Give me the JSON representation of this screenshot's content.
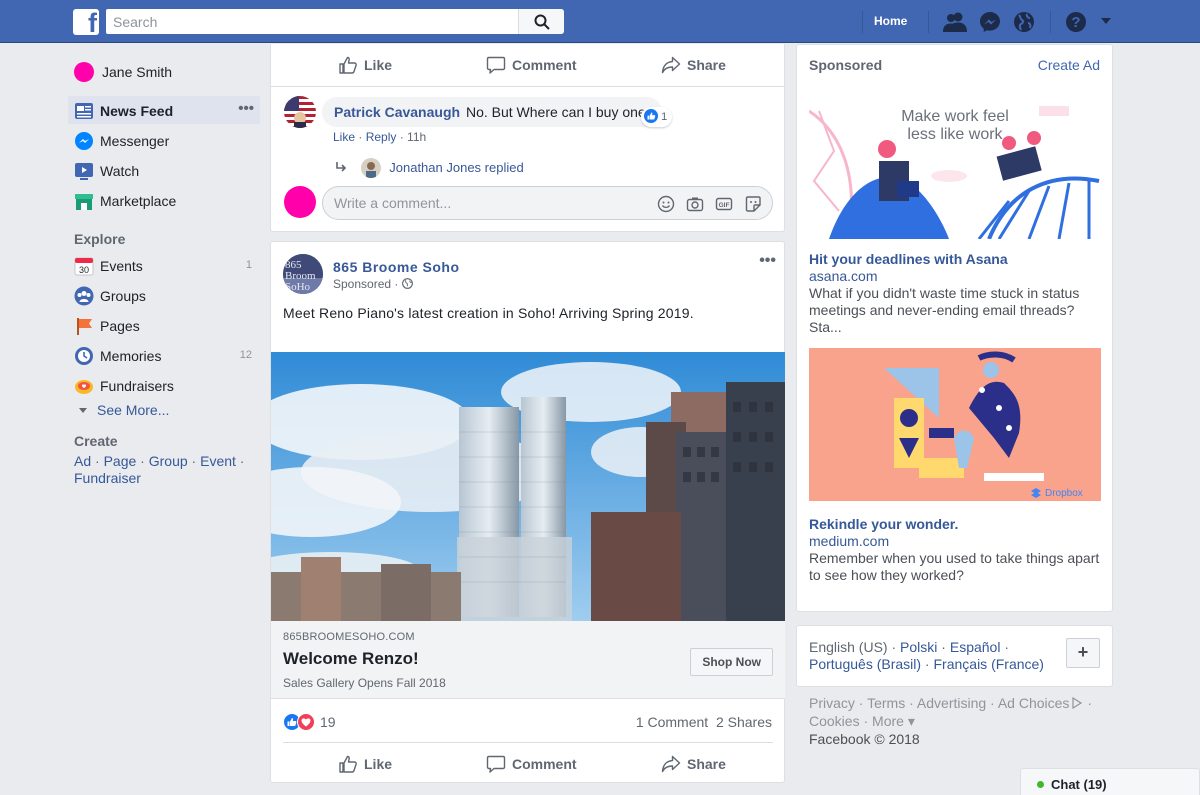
{
  "header": {
    "search_placeholder": "Search",
    "home_label": "Home"
  },
  "leftnav": {
    "user_name": "Jane Smith",
    "items": [
      {
        "label": "News Feed",
        "count": ""
      },
      {
        "label": "Messenger",
        "count": ""
      },
      {
        "label": "Watch",
        "count": ""
      },
      {
        "label": "Marketplace",
        "count": ""
      }
    ],
    "explore_title": "Explore",
    "explore": [
      {
        "label": "Events",
        "count": "1"
      },
      {
        "label": "Groups",
        "count": ""
      },
      {
        "label": "Pages",
        "count": ""
      },
      {
        "label": "Memories",
        "count": "12"
      },
      {
        "label": "Fundraisers",
        "count": ""
      }
    ],
    "see_more": "See More...",
    "create_title": "Create",
    "create_links": [
      "Ad",
      "Page",
      "Group",
      "Event",
      "Fundraiser"
    ]
  },
  "actions": {
    "like": "Like",
    "comment": "Comment",
    "share": "Share"
  },
  "comment": {
    "author": "Patrick Cavanaugh",
    "text": "No. But Where can I buy one.",
    "like_count": "1",
    "like_link": "Like",
    "reply_link": "Reply",
    "time": "11h",
    "replied": "Jonathan Jones replied",
    "placeholder": "Write a comment..."
  },
  "post": {
    "page_name": "865 Broome Soho",
    "avatar_text": "865 Broome Soho",
    "sponsored": "Sponsored",
    "text": "Meet Reno Piano's latest creation in Soho! Arriving Spring 2019.",
    "link_domain": "865BROOMESOHO.COM",
    "link_title": "Welcome Renzo!",
    "link_sub": "Sales Gallery Opens Fall 2018",
    "cta": "Shop Now",
    "reaction_count": "19",
    "comments_count": "1 Comment",
    "shares_count": "2 Shares"
  },
  "sponsored": {
    "title": "Sponsored",
    "create_ad": "Create Ad",
    "ads": [
      {
        "image_text": "Make work feel less like work",
        "title": "Hit your deadlines with Asana",
        "domain": "asana.com",
        "desc": "What if you didn't waste time stuck in status meetings and never-ending email threads? Sta..."
      },
      {
        "image_text": "Dropbox",
        "title": "Rekindle your wonder.",
        "domain": "medium.com",
        "desc": "Remember when you used to take things apart to see how they worked?"
      }
    ]
  },
  "languages": {
    "current": "English (US)",
    "others": [
      "Polski",
      "Español",
      "Português (Brasil)",
      "Français (France)"
    ],
    "plus": "+"
  },
  "footer": {
    "links": [
      "Privacy",
      "Terms",
      "Advertising",
      "Ad Choices",
      "Cookies",
      "More"
    ],
    "copyright": "Facebook © 2018"
  },
  "chat": {
    "label": "Chat (19)"
  },
  "colors": {
    "brand": "#4267b2",
    "link": "#385898",
    "user_dot": "#ff00aa"
  }
}
